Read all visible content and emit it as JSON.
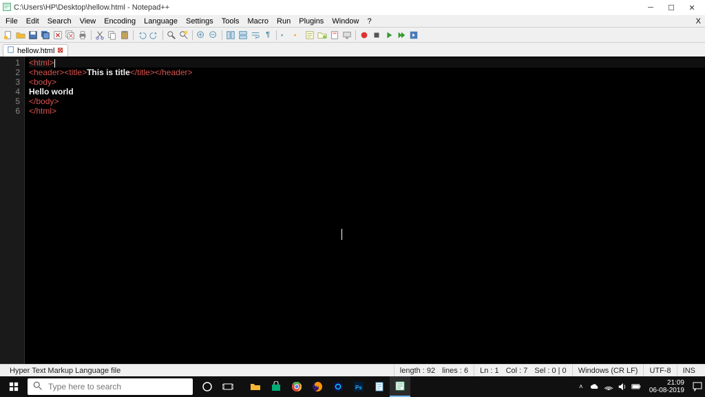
{
  "titlebar": {
    "title": "C:\\Users\\HP\\Desktop\\hellow.html - Notepad++"
  },
  "menubar": {
    "items": [
      "File",
      "Edit",
      "Search",
      "View",
      "Encoding",
      "Language",
      "Settings",
      "Tools",
      "Macro",
      "Run",
      "Plugins",
      "Window",
      "?"
    ]
  },
  "tabs": {
    "active_label": "hellow.html"
  },
  "code": {
    "lines": [
      {
        "n": "1",
        "pre": "<html>",
        "mid": "",
        "post": ""
      },
      {
        "n": "2",
        "pre": "<header><title>",
        "mid": "This is title",
        "post": "</title></header>"
      },
      {
        "n": "3",
        "pre": "<body>",
        "mid": "",
        "post": ""
      },
      {
        "n": "4",
        "pre": "",
        "mid": "Hello world",
        "post": ""
      },
      {
        "n": "5",
        "pre": "</body>",
        "mid": "",
        "post": ""
      },
      {
        "n": "6",
        "pre": "</html>",
        "mid": "",
        "post": ""
      }
    ]
  },
  "statusbar": {
    "filetype": "Hyper Text Markup Language file",
    "length": "length : 92",
    "lines": "lines : 6",
    "ln": "Ln : 1",
    "col": "Col : 7",
    "sel": "Sel : 0 | 0",
    "eol": "Windows (CR LF)",
    "encoding": "UTF-8",
    "mode": "INS"
  },
  "taskbar": {
    "search_placeholder": "Type here to search",
    "time": "21:09",
    "date": "06-08-2019"
  }
}
